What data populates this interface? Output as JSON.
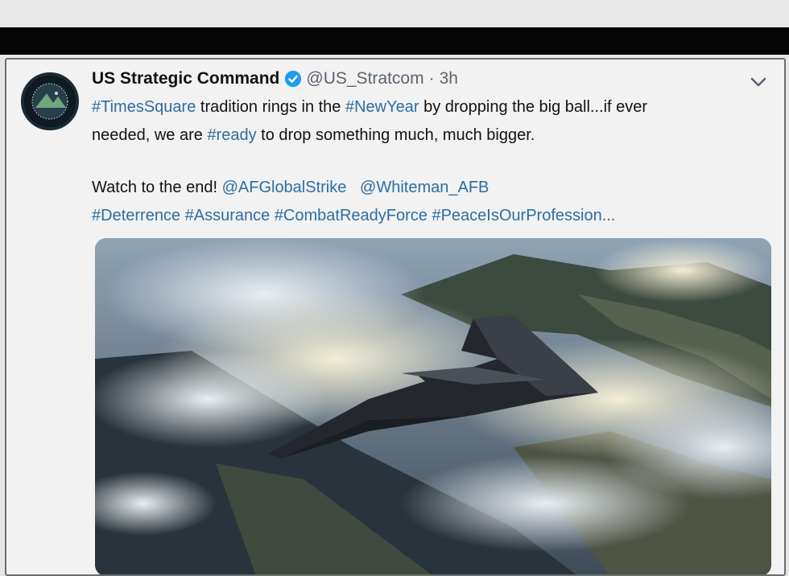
{
  "tweet": {
    "display_name": "US Strategic Command",
    "handle": "@US_Stratcom",
    "separator": "·",
    "time": "3h",
    "line1": {
      "ht1": "#TimesSquare",
      "t1": " tradition rings in the ",
      "ht2": "#NewYear",
      "t2": " by dropping the big ball...if ever"
    },
    "line2": {
      "t1": "needed, we are ",
      "ht1": "#ready",
      "t2": " to drop something much, much bigger."
    },
    "line3": {
      "t1": "Watch to the end! ",
      "m1": "@AFGlobalStrike",
      "m2": "@Whiteman_AFB"
    },
    "line4": {
      "h1": "#Deterrence",
      "h2": "#Assurance",
      "h3": "#CombatReadyForce",
      "h4": "#PeaceIsOurProfession..."
    }
  },
  "icons": {
    "verified": "verified-badge-icon",
    "menu": "chevron-down-icon"
  },
  "colors": {
    "link": "#2d6da3",
    "verified": "#1d9bf0",
    "black_bar": "#050505"
  }
}
